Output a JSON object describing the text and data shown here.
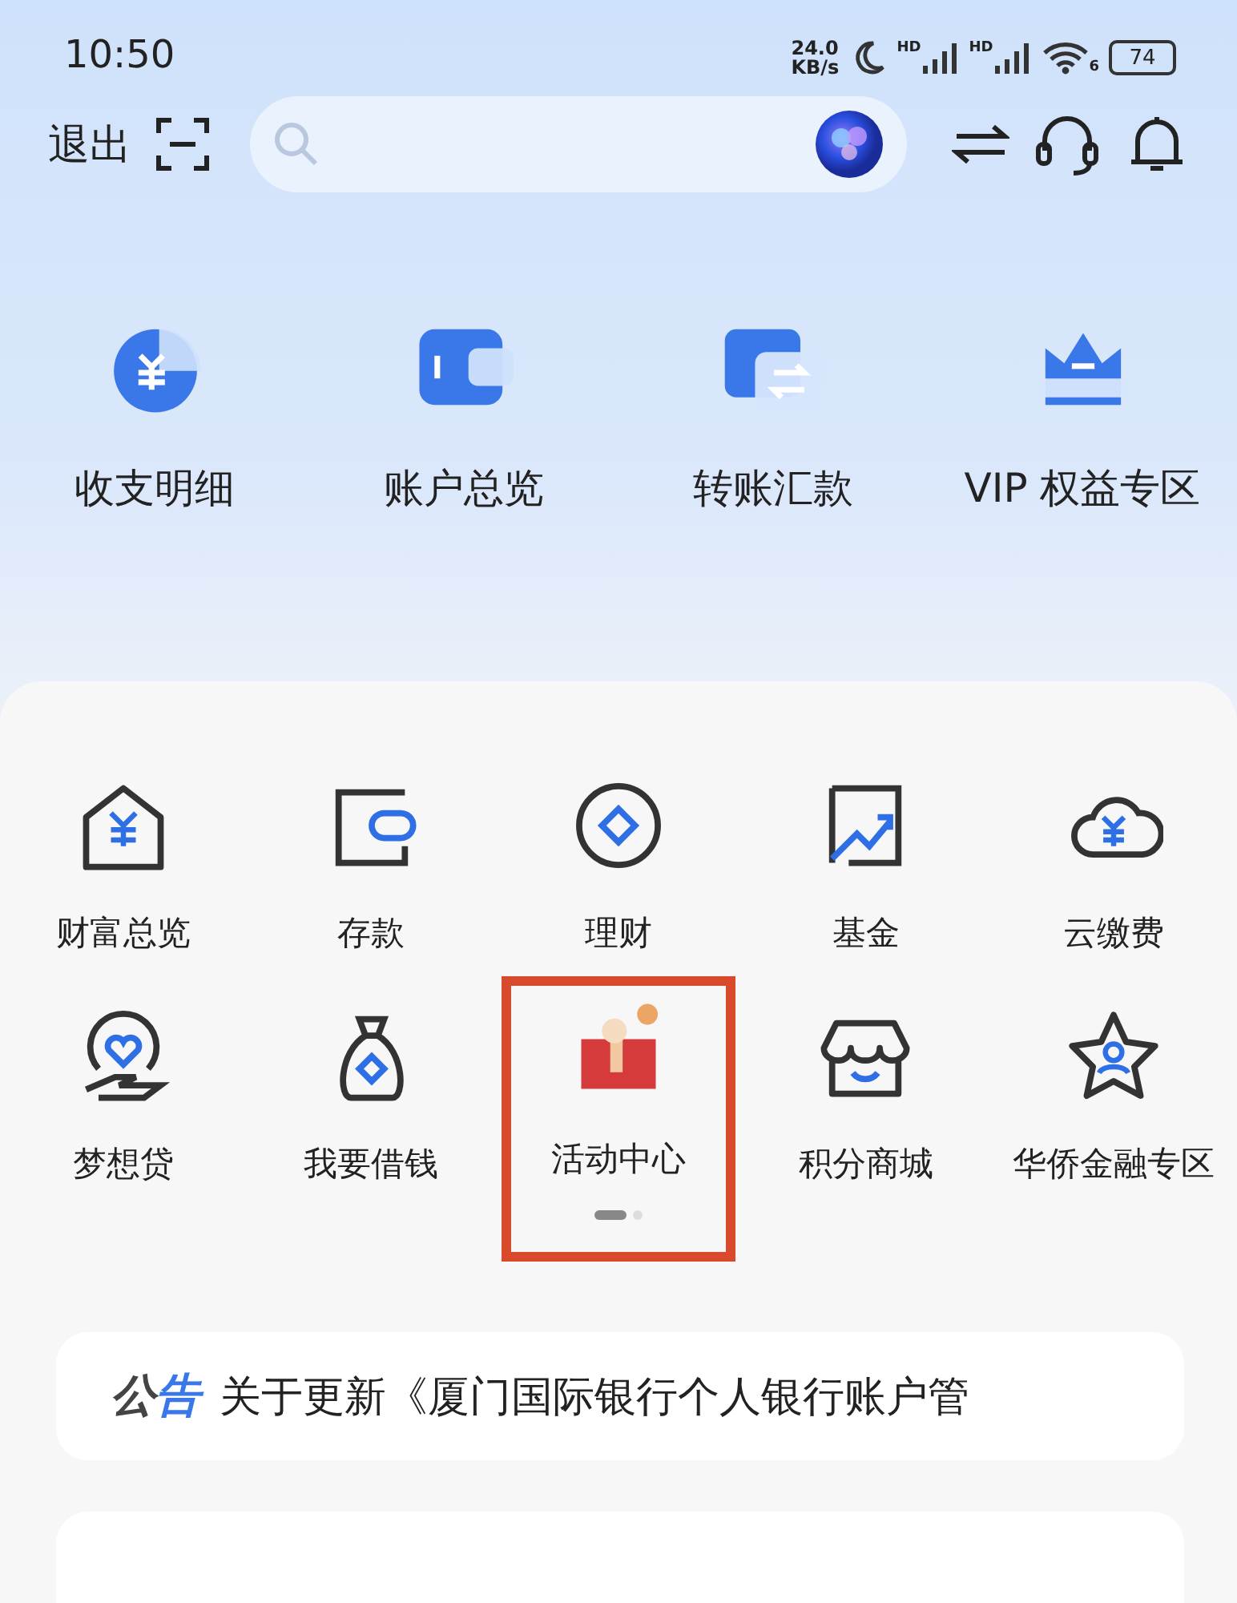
{
  "status_bar": {
    "time": "10:50",
    "speed_value": "24.0",
    "speed_unit": "KB/s",
    "signal_labels": [
      "HD",
      "HD"
    ],
    "wifi_label": "6",
    "battery": "74"
  },
  "top_bar": {
    "exit": "退出"
  },
  "quick_actions": [
    {
      "label": "收支明细"
    },
    {
      "label": "账户总览"
    },
    {
      "label": "转账汇款"
    },
    {
      "label": "VIP 权益专区"
    }
  ],
  "services": [
    {
      "label": "财富总览",
      "highlighted": false
    },
    {
      "label": "存款",
      "highlighted": false
    },
    {
      "label": "理财",
      "highlighted": false
    },
    {
      "label": "基金",
      "highlighted": false
    },
    {
      "label": "云缴费",
      "highlighted": false
    },
    {
      "label": "梦想贷",
      "highlighted": false
    },
    {
      "label": "我要借钱",
      "highlighted": false
    },
    {
      "label": "活动中心",
      "highlighted": true
    },
    {
      "label": "积分商城",
      "highlighted": false
    },
    {
      "label": "华侨金融专区",
      "highlighted": false
    }
  ],
  "page_indicator": [
    {
      "selected": true
    },
    {
      "selected": false
    }
  ],
  "notice": {
    "tag_first": "公",
    "tag_second": "告",
    "text": "关于更新《厦门国际银行个人银行账户管"
  }
}
